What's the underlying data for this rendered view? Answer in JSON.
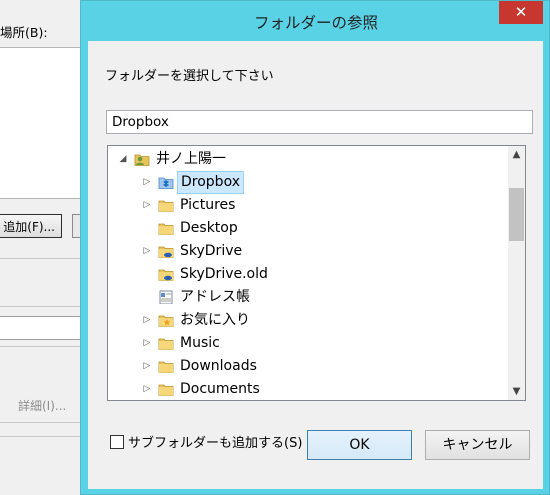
{
  "background": {
    "label": "場所(B):",
    "add_button": "追加(F)...",
    "detail_button": "詳細(I)..."
  },
  "dialog": {
    "title": "フォルダーの参照",
    "close_label": "✕",
    "instruction": "フォルダーを選択して下さい",
    "path_value": "Dropbox",
    "checkbox_label": "サブフォルダーも追加する(S)",
    "ok_label": "OK",
    "cancel_label": "キャンセル"
  },
  "tree": [
    {
      "label": "井ノ上陽一",
      "icon": "user-folder-icon",
      "expander": "expanded",
      "depth": 0
    },
    {
      "label": "Dropbox",
      "icon": "dropbox-folder-icon",
      "expander": "collapsed",
      "depth": 1,
      "selected": true
    },
    {
      "label": "Pictures",
      "icon": "folder-icon",
      "expander": "collapsed",
      "depth": 1
    },
    {
      "label": "Desktop",
      "icon": "folder-icon",
      "expander": "none",
      "depth": 1
    },
    {
      "label": "SkyDrive",
      "icon": "skydrive-folder-icon",
      "expander": "collapsed",
      "depth": 1
    },
    {
      "label": "SkyDrive.old",
      "icon": "skydrive-folder-icon",
      "expander": "none",
      "depth": 1
    },
    {
      "label": "アドレス帳",
      "icon": "contacts-folder-icon",
      "expander": "none",
      "depth": 1
    },
    {
      "label": "お気に入り",
      "icon": "favorites-folder-icon",
      "expander": "collapsed",
      "depth": 1
    },
    {
      "label": "Music",
      "icon": "folder-icon",
      "expander": "collapsed",
      "depth": 1
    },
    {
      "label": "Downloads",
      "icon": "folder-icon",
      "expander": "collapsed",
      "depth": 1
    },
    {
      "label": "Documents",
      "icon": "folder-icon",
      "expander": "collapsed",
      "depth": 1
    }
  ]
}
